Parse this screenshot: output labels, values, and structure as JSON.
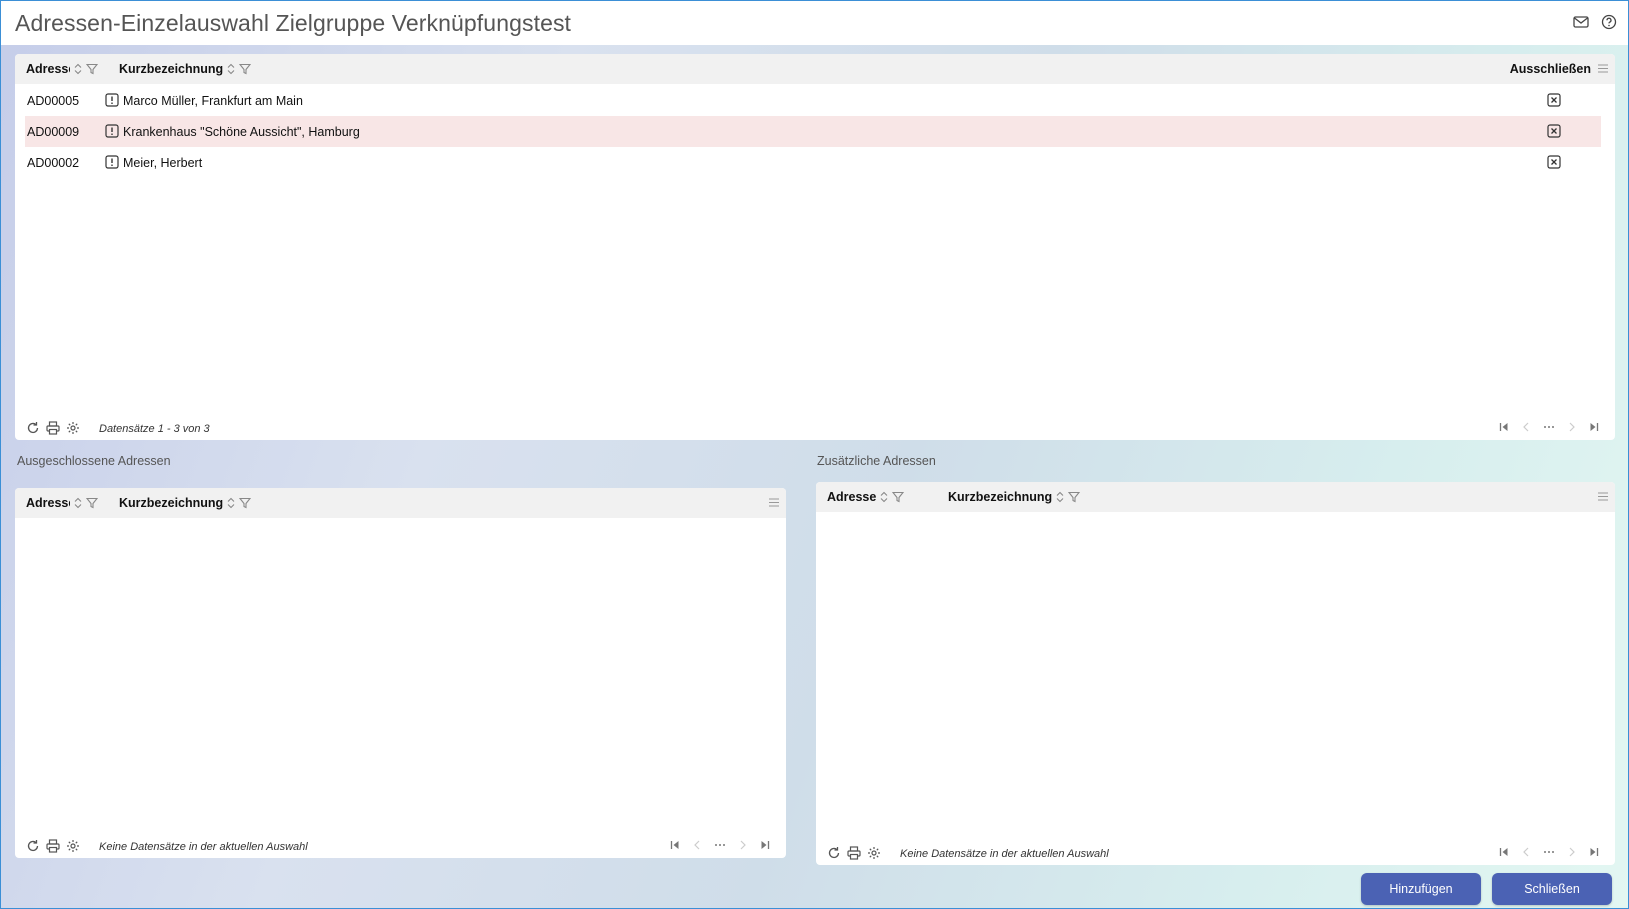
{
  "window": {
    "title": "Adressen-Einzelauswahl Zielgruppe Verknüpfungstest",
    "icons": [
      "mail-icon",
      "help-icon"
    ]
  },
  "main_grid": {
    "columns": {
      "address": "Adresse",
      "short_name": "Kurzbezeichnung",
      "exclude": "Ausschließen"
    },
    "rows": [
      {
        "id": "AD00005",
        "name": "Marco Müller, Frankfurt am Main",
        "highlighted": false
      },
      {
        "id": "AD00009",
        "name": "Krankenhaus \"Schöne Aussicht\", Hamburg",
        "highlighted": true
      },
      {
        "id": "AD00002",
        "name": "Meier, Herbert",
        "highlighted": false
      }
    ],
    "status": "Datensätze 1 - 3 von 3"
  },
  "excluded": {
    "label": "Ausgeschlossene Adressen",
    "columns": {
      "address": "Adresse",
      "short_name": "Kurzbezeichnung"
    },
    "status": "Keine Datensätze in der aktuellen Auswahl"
  },
  "additional": {
    "label": "Zusätzliche Adressen",
    "columns": {
      "address": "Adresse",
      "short_name": "Kurzbezeichnung"
    },
    "status": "Keine Datensätze in der aktuellen Auswahl"
  },
  "buttons": {
    "add": "Hinzufügen",
    "close": "Schließen"
  },
  "colors": {
    "accent": "#4b62b4",
    "highlight_row": "#f8e6e6",
    "header_bg": "#f1f1f1"
  }
}
